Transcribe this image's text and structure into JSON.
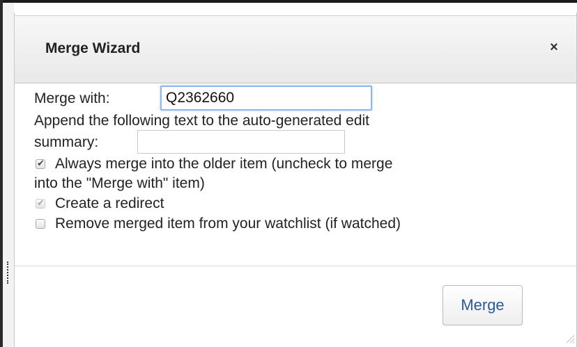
{
  "dialog": {
    "title": "Merge Wizard",
    "close_glyph": "×"
  },
  "form": {
    "merge_with_label": "Merge with:",
    "merge_with_value": "Q2362660",
    "append_text_label_line1": "Append the following text to the auto-generated edit",
    "append_text_label_line2": "summary:",
    "append_text_value": "",
    "options": [
      {
        "label_line1": "Always merge into the older item (uncheck to merge",
        "label_line2": "into the \"Merge with\" item)",
        "checked": true,
        "disabled": false
      },
      {
        "label_line1": "Create a redirect",
        "checked": true,
        "disabled": true
      },
      {
        "label_line1": "Remove merged item from your watchlist (if watched)",
        "checked": false,
        "disabled": false
      }
    ]
  },
  "buttons": {
    "merge_label": "Merge"
  },
  "icons": {
    "checkmark": "check-icon",
    "close": "close-icon",
    "resize": "resize-grip-icon"
  }
}
